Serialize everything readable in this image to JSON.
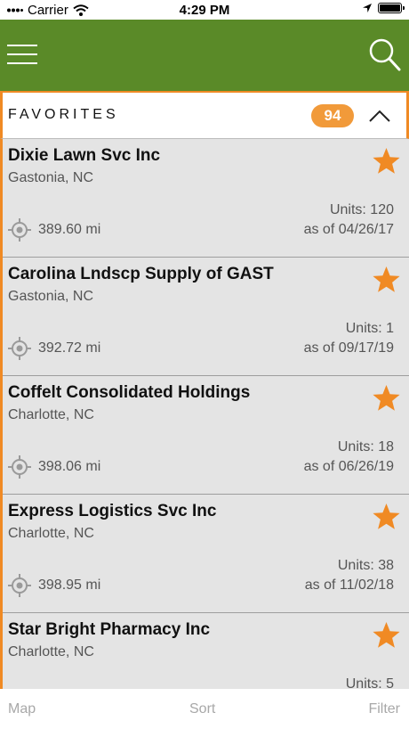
{
  "status_bar": {
    "carrier": "Carrier",
    "time": "4:29 PM"
  },
  "colors": {
    "header_green": "#5a8a28",
    "accent_orange": "#f08a24",
    "row_background": "#e4e4e4"
  },
  "favorites": {
    "title": "FAVORITES",
    "count": "94"
  },
  "items": [
    {
      "name": "Dixie Lawn Svc Inc",
      "location": "Gastonia, NC",
      "distance": "389.60 mi",
      "units": "Units: 120",
      "as_of": "as of 04/26/17"
    },
    {
      "name": "Carolina Lndscp Supply of GAST",
      "location": "Gastonia, NC",
      "distance": "392.72 mi",
      "units": "Units: 1",
      "as_of": "as of 09/17/19"
    },
    {
      "name": "Coffelt Consolidated Holdings",
      "location": "Charlotte, NC",
      "distance": "398.06 mi",
      "units": "Units: 18",
      "as_of": "as of 06/26/19"
    },
    {
      "name": "Express Logistics Svc Inc",
      "location": "Charlotte, NC",
      "distance": "398.95 mi",
      "units": "Units: 38",
      "as_of": "as of 11/02/18"
    },
    {
      "name": "Star Bright Pharmacy Inc",
      "location": "Charlotte, NC",
      "distance": "",
      "units": "Units: 5",
      "as_of": ""
    }
  ],
  "tabs": {
    "map": "Map",
    "sort": "Sort",
    "filter": "Filter"
  },
  "icons": {
    "menu": "menu-icon",
    "search": "search-icon",
    "collapse": "chevron-up-icon",
    "favorite": "star-icon",
    "location": "location-target-icon"
  }
}
